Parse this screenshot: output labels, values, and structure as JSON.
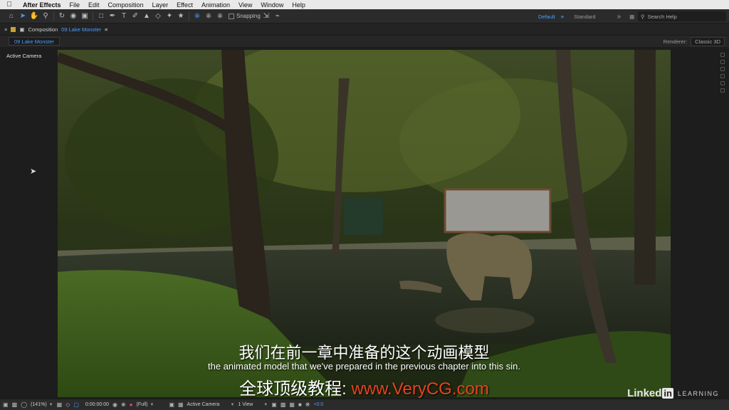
{
  "menubar": {
    "app": "After Effects",
    "items": [
      "File",
      "Edit",
      "Composition",
      "Layer",
      "Effect",
      "Animation",
      "View",
      "Window",
      "Help"
    ]
  },
  "toolbar": {
    "snapping_label": "Snapping",
    "workspaces": [
      "Default",
      "Standard"
    ],
    "active_workspace": "Default",
    "search_placeholder": "Search Help"
  },
  "panel": {
    "prefix": "Composition",
    "comp_name": "09 Lake Monster",
    "tab": "09 Lake Monster",
    "renderer_label": "Renderer:",
    "renderer_value": "Classic 3D"
  },
  "viewer": {
    "camera_label": "Active Camera"
  },
  "subtitles": {
    "chinese": "我们在前一章中准备的这个动画模型",
    "english": "the animated model that we've prepared in the previous chapter into this sin.",
    "watermark_prefix": "全球顶级教程: ",
    "watermark_url": "www.VeryCG.com"
  },
  "branding": {
    "linked": "Linked",
    "in": "in",
    "learning": "LEARNING"
  },
  "bottombar": {
    "zoom": "(141%)",
    "timecode": "0:00:00:00",
    "resolution": "(Full)",
    "view_camera": "Active Camera",
    "view_layout": "1 View",
    "exposure": "+0.0"
  },
  "colors": {
    "accent": "#4a9eff",
    "watermark_url": "#e8421e"
  }
}
